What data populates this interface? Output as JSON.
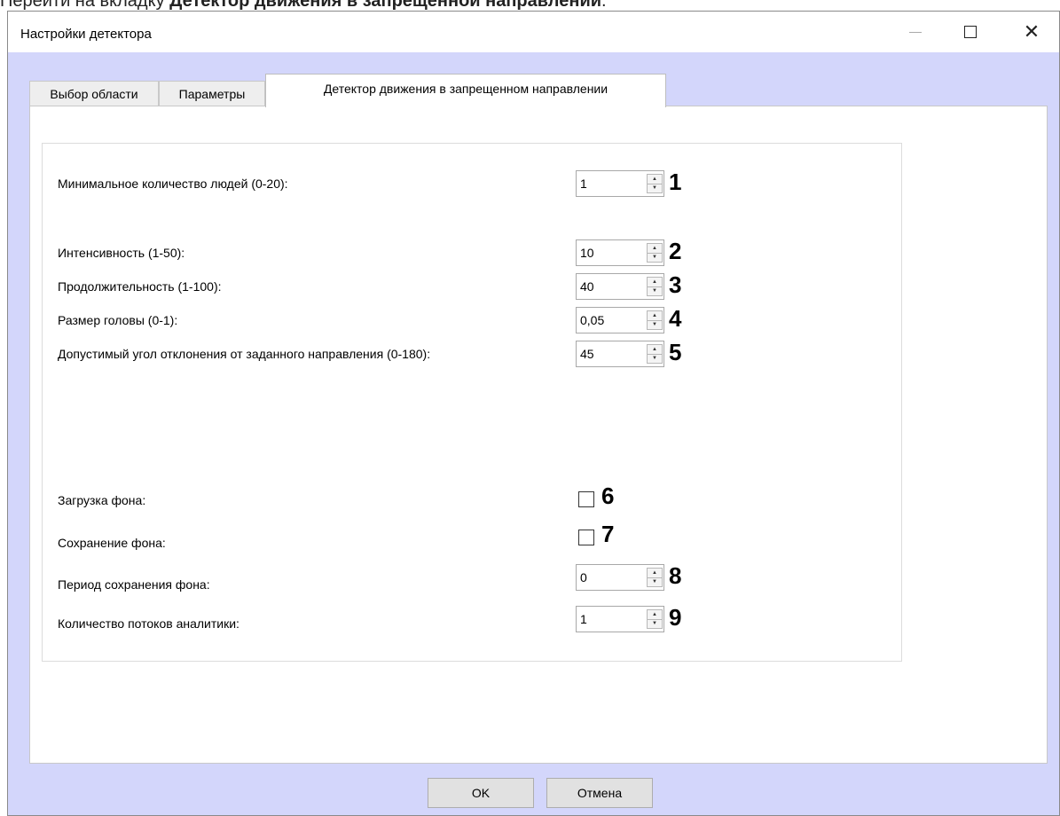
{
  "instruction": {
    "prefix": "Перейти на вкладку ",
    "bold": "Детектор движения в запрещенной направлении",
    "suffix": "."
  },
  "window": {
    "title": "Настройки детектора",
    "minimize": "—",
    "maximize": "□",
    "close": "✕"
  },
  "tabs": [
    {
      "label": "Выбор области",
      "active": false
    },
    {
      "label": "Параметры",
      "active": false
    },
    {
      "label": "Детектор движения в запрещенном направлении",
      "active": true
    }
  ],
  "fields": [
    {
      "label": "Минимальное количество людей (0-20):",
      "value": "1",
      "marker": "1"
    },
    {
      "label": "Интенсивность (1-50):",
      "value": "10",
      "marker": "2"
    },
    {
      "label": "Продолжительность (1-100):",
      "value": "40",
      "marker": "3"
    },
    {
      "label": "Размер головы (0-1):",
      "value": "0,05",
      "marker": "4"
    },
    {
      "label": "Допустимый угол отклонения от заданного направления (0-180):",
      "value": "45",
      "marker": "5"
    }
  ],
  "checkboxes": [
    {
      "label": "Загрузка фона:",
      "checked": false,
      "marker": "6"
    },
    {
      "label": "Сохранение фона:",
      "checked": false,
      "marker": "7"
    }
  ],
  "fields2": [
    {
      "label": "Период сохранения фона:",
      "value": "0",
      "marker": "8"
    },
    {
      "label": "Количество потоков аналитики:",
      "value": "1",
      "marker": "9"
    }
  ],
  "buttons": {
    "ok": "OK",
    "cancel": "Отмена"
  },
  "colors": {
    "window_bg": "#d3d6fb",
    "panel_bg": "#ffffff"
  }
}
